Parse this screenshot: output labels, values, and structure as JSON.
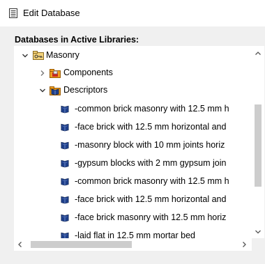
{
  "window": {
    "title": "Edit Database"
  },
  "section_label": "Databases in Active Libraries:",
  "tree": {
    "root": {
      "label": "Masonry",
      "icon": "key-folder-icon",
      "expanded": true
    },
    "components": {
      "label": "Components",
      "icon": "folder-icon",
      "expanded": false
    },
    "descriptors": {
      "label": "Descriptors",
      "icon": "book-folder-icon",
      "expanded": true,
      "items": [
        "-common brick masonry with 12.5 mm h",
        "-face brick with 12.5 mm horizontal and",
        "-masonry block with 10 mm joints horiz",
        "-gypsum blocks with 2 mm gypsum join",
        "-common brick masonry with 12.5 mm h",
        "-face brick with 12.5 mm horizontal and",
        "-face brick masonry with 12.5 mm horiz",
        "-laid flat in 12.5 mm mortar bed"
      ]
    }
  },
  "colors": {
    "accent_blue": "#1e3f8a",
    "folder_orange": "#f0a020",
    "folder_red": "#c8281e"
  }
}
